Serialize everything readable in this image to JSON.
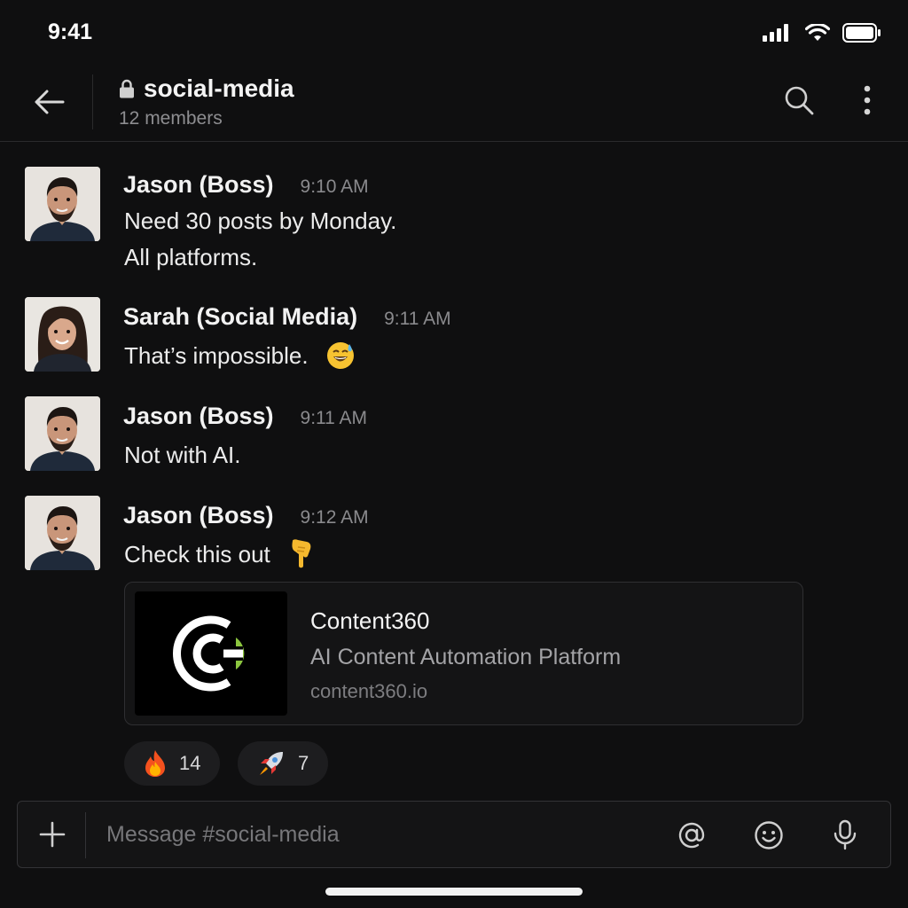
{
  "status_bar": {
    "time": "9:41"
  },
  "header": {
    "channel_name": "social-media",
    "member_count": "12 members"
  },
  "messages": [
    {
      "author": "Jason (Boss)",
      "time": "9:10 AM",
      "lines": [
        "Need 30 posts by Monday.",
        "All platforms."
      ]
    },
    {
      "author": "Sarah (Social Media)",
      "time": "9:11 AM",
      "lines": [
        "That’s impossible."
      ],
      "emoji": "sweat-smile-emoji"
    },
    {
      "author": "Jason (Boss)",
      "time": "9:11 AM",
      "lines": [
        "Not with AI."
      ]
    },
    {
      "author": "Jason (Boss)",
      "time": "9:12 AM",
      "lines": [
        "Check this out"
      ],
      "emoji": "pointing-down-emoji"
    }
  ],
  "link_card": {
    "title": "Content360",
    "description": "AI Content Automation Platform",
    "url": "content360.io",
    "brand_colors": {
      "logo_white": "#ffffff",
      "logo_green": "#8cc63f"
    }
  },
  "reactions": [
    {
      "emoji": "fire-emoji",
      "count": "14"
    },
    {
      "emoji": "rocket-emoji",
      "count": "7"
    }
  ],
  "composer": {
    "placeholder": "Message #social-media"
  }
}
